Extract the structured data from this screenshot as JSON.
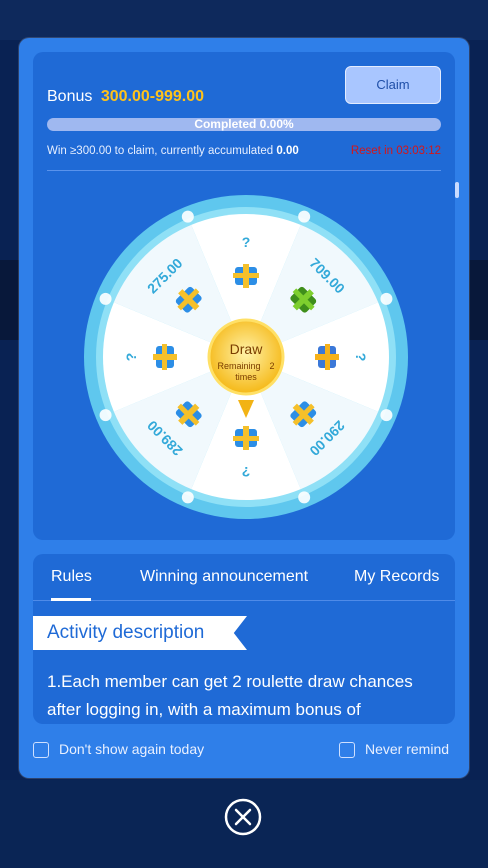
{
  "bonus": {
    "label": "Bonus",
    "amount": "300.00-999.00",
    "claim_label": "Claim"
  },
  "progress": {
    "text": "Completed 0.00%",
    "value": 0
  },
  "condition": {
    "text": "Win ≥300.00 to claim, currently accumulated",
    "value": "0.00"
  },
  "reset": {
    "text": "Reset in 03:03:12"
  },
  "wheel": {
    "center_label": "Draw",
    "remaining_label": "Remaining",
    "remaining_count": "2",
    "remaining_unit": "times",
    "segments": [
      {
        "label": "?",
        "icon": "gift-box-icon"
      },
      {
        "label": "709.00",
        "icon": "cash-stack-icon"
      },
      {
        "label": "?",
        "icon": "coin-bag-icon"
      },
      {
        "label": "290.00",
        "icon": "gift-box-icon"
      },
      {
        "label": "?",
        "icon": "gift-box-icon"
      },
      {
        "label": "289.00",
        "icon": "gift-box-icon"
      },
      {
        "label": "?",
        "icon": "gift-box-icon"
      },
      {
        "label": "275.00",
        "icon": "gift-box-icon"
      }
    ]
  },
  "tabs": [
    {
      "label": "Rules",
      "active": true
    },
    {
      "label": "Winning announcement",
      "active": false
    },
    {
      "label": "My Records",
      "active": false
    }
  ],
  "rules": {
    "heading": "Activity description",
    "text": "1.Each member can get 2 roulette draw chances after logging in, with a maximum bonus of"
  },
  "footer": {
    "dont_show_today": "Don't show again today",
    "never_remind": "Never remind"
  },
  "colors": {
    "accent": "#ffc21a",
    "modal": "#2f7fe9",
    "panel": "#1f6ad6",
    "reset": "#d4161a"
  }
}
